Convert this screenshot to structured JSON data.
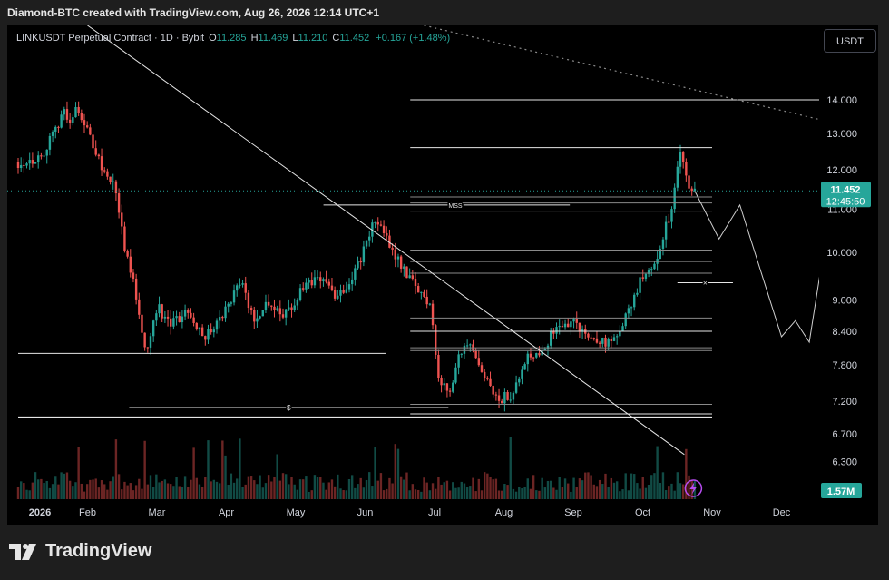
{
  "header": {
    "title": "Diamond-BTC created with TradingView.com, Aug 26, 2026 12:14 UTC+1"
  },
  "legend": {
    "symbol": "LINKUSDT Perpetual Contract · 1D · Bybit",
    "o_label": "O",
    "o_value": "11.285",
    "h_label": "H",
    "h_value": "11.469",
    "l_label": "L",
    "l_value": "11.210",
    "c_label": "C",
    "c_value": "11.452",
    "change": "+0.167 (+1.48%)"
  },
  "currency_button": "USDT",
  "price_badge": {
    "price": "11.452",
    "countdown": "12:45:50"
  },
  "volume_badge": "1.57M",
  "footer": {
    "brand": "TradingView"
  },
  "annotations": {
    "mss": "MSS",
    "dollar": "$",
    "cross": "×"
  },
  "colors": {
    "up": "#26a69a",
    "down": "#ef5350",
    "background": "#000000",
    "header": "#1e1e1e"
  },
  "chart_data": {
    "type": "candlestick",
    "title": "LINKUSDT Perpetual Contract · 1D · Bybit",
    "x_tick_labels": [
      "2026",
      "Feb",
      "Mar",
      "Apr",
      "May",
      "Jun",
      "Jul",
      "Aug",
      "Sep",
      "Oct",
      "Nov",
      "Dec"
    ],
    "y_tick_labels": [
      14.0,
      13.0,
      12.0,
      11.0,
      10.0,
      9.0,
      8.4,
      7.8,
      7.2,
      6.7,
      6.3
    ],
    "y_scale": "log",
    "y_range": [
      6.0,
      16.5
    ],
    "last_price": 11.452,
    "price_path": [
      {
        "month": 0.0,
        "price": 12.2
      },
      {
        "month": 0.3,
        "price": 12.3
      },
      {
        "month": 0.5,
        "price": 12.9
      },
      {
        "month": 0.65,
        "price": 13.7
      },
      {
        "month": 0.75,
        "price": 13.2
      },
      {
        "month": 0.85,
        "price": 13.9
      },
      {
        "month": 0.95,
        "price": 13.3
      },
      {
        "month": 1.05,
        "price": 12.8
      },
      {
        "month": 1.2,
        "price": 12.1
      },
      {
        "month": 1.4,
        "price": 11.5
      },
      {
        "month": 1.55,
        "price": 10.0
      },
      {
        "month": 1.7,
        "price": 9.1
      },
      {
        "month": 1.85,
        "price": 8.0
      },
      {
        "month": 2.0,
        "price": 8.9
      },
      {
        "month": 2.2,
        "price": 8.5
      },
      {
        "month": 2.45,
        "price": 8.8
      },
      {
        "month": 2.7,
        "price": 8.3
      },
      {
        "month": 2.95,
        "price": 8.7
      },
      {
        "month": 3.2,
        "price": 9.4
      },
      {
        "month": 3.4,
        "price": 8.6
      },
      {
        "month": 3.6,
        "price": 9.0
      },
      {
        "month": 3.85,
        "price": 8.7
      },
      {
        "month": 4.1,
        "price": 9.2
      },
      {
        "month": 4.35,
        "price": 9.5
      },
      {
        "month": 4.55,
        "price": 9.1
      },
      {
        "month": 4.75,
        "price": 9.3
      },
      {
        "month": 5.0,
        "price": 10.1
      },
      {
        "month": 5.15,
        "price": 10.8
      },
      {
        "month": 5.3,
        "price": 10.3
      },
      {
        "month": 5.5,
        "price": 9.8
      },
      {
        "month": 5.7,
        "price": 9.3
      },
      {
        "month": 5.95,
        "price": 8.9
      },
      {
        "month": 6.05,
        "price": 7.6
      },
      {
        "month": 6.2,
        "price": 7.3
      },
      {
        "month": 6.35,
        "price": 8.0
      },
      {
        "month": 6.5,
        "price": 8.1
      },
      {
        "month": 6.7,
        "price": 7.6
      },
      {
        "month": 6.9,
        "price": 7.2
      },
      {
        "month": 7.1,
        "price": 7.3
      },
      {
        "month": 7.3,
        "price": 7.9
      },
      {
        "month": 7.55,
        "price": 8.1
      },
      {
        "month": 7.8,
        "price": 8.5
      },
      {
        "month": 8.0,
        "price": 8.6
      },
      {
        "month": 8.2,
        "price": 8.3
      },
      {
        "month": 8.45,
        "price": 8.2
      },
      {
        "month": 8.6,
        "price": 8.2
      },
      {
        "month": 8.8,
        "price": 8.8
      },
      {
        "month": 9.0,
        "price": 9.5
      },
      {
        "month": 9.2,
        "price": 9.9
      },
      {
        "month": 9.4,
        "price": 10.9
      },
      {
        "month": 9.55,
        "price": 12.5
      },
      {
        "month": 9.65,
        "price": 11.6
      },
      {
        "month": 9.75,
        "price": 11.45
      }
    ],
    "levels": [
      14.0,
      12.6,
      11.3,
      11.15,
      10.95,
      10.05,
      9.8,
      9.55,
      8.65,
      8.4,
      8.1,
      8.05,
      7.15,
      7.0
    ],
    "projection": [
      {
        "month": 9.75,
        "price": 11.45
      },
      {
        "month": 10.1,
        "price": 10.3
      },
      {
        "month": 10.4,
        "price": 11.1
      },
      {
        "month": 11.0,
        "price": 8.3
      },
      {
        "month": 11.2,
        "price": 8.6
      },
      {
        "month": 11.4,
        "price": 8.2
      },
      {
        "month": 11.95,
        "price": 14.0
      }
    ],
    "trendline": {
      "start": {
        "month": 1.0,
        "price": 16.5
      },
      "end": {
        "month": 9.6,
        "price": 6.4
      }
    },
    "volume_last": "1.57M"
  }
}
